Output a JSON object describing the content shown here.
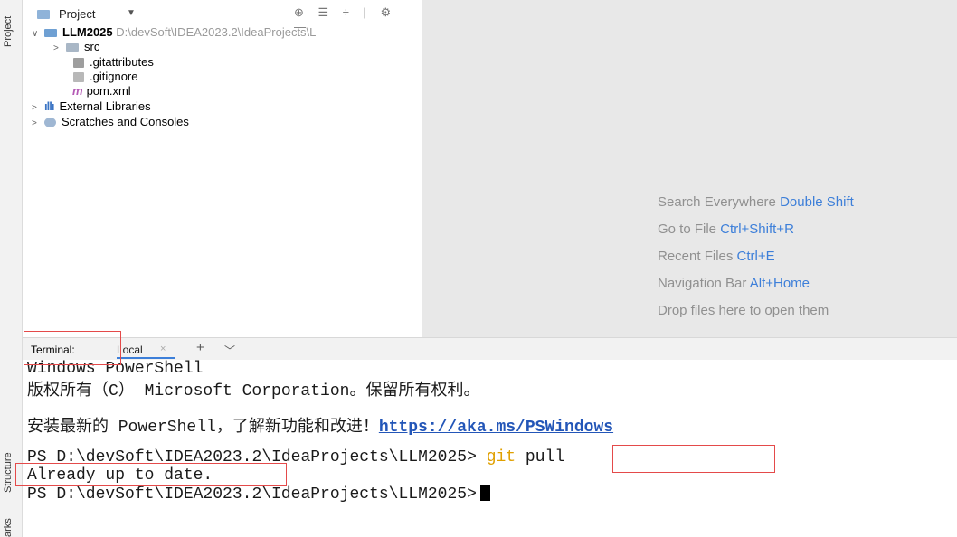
{
  "side_strip": {
    "project_label": "Project",
    "structure_label": "Structure",
    "bookmarks_label": "arks"
  },
  "project_panel": {
    "title": "Project",
    "tools": "⊕ ☰ ÷ | ⚙ —",
    "tree": [
      {
        "label": "LLM2025",
        "path": "D:\\devSoft\\IDEA2023.2\\IdeaProjects\\L"
      },
      {
        "label": "src"
      },
      {
        "label": ".gitattributes"
      },
      {
        "label": ".gitignore"
      },
      {
        "label": "pom.xml",
        "icon": "m"
      },
      {
        "label": "External Libraries"
      },
      {
        "label": "Scratches and Consoles"
      }
    ]
  },
  "editor_hints": [
    {
      "text": "Search Everywhere",
      "key": "Double Shift"
    },
    {
      "text": "Go to File",
      "key": "Ctrl+Shift+R"
    },
    {
      "text": "Recent Files",
      "key": "Ctrl+E"
    },
    {
      "text": "Navigation Bar",
      "key": "Alt+Home"
    },
    {
      "text": "Drop files here to open them",
      "key": ""
    }
  ],
  "terminal": {
    "label": "Terminal:",
    "tab": "Local",
    "tab_close": "×",
    "plus": "+",
    "caret": "﹀",
    "lines": {
      "l1": "Windows PowerShell",
      "l2": "版权所有（C） Microsoft Corporation。保留所有权利。",
      "l3_prefix": "安装最新的 PowerShell，了解新功能和改进！",
      "l3_link": "https://aka.ms/PSWindows",
      "l4_prompt": "PS D:\\devSoft\\IDEA2023.2\\IdeaProjects\\LLM2025>",
      "l4_cmd_git": "git",
      "l4_cmd_rest": "pull",
      "l5": "Already up to date.",
      "l6_prompt": "PS D:\\devSoft\\IDEA2023.2\\IdeaProjects\\LLM2025>"
    }
  },
  "colors": {
    "highlight": "#e44a4a",
    "link": "#2356b8",
    "accent": "#3d7fd9",
    "git_keyword": "#e0a000"
  }
}
